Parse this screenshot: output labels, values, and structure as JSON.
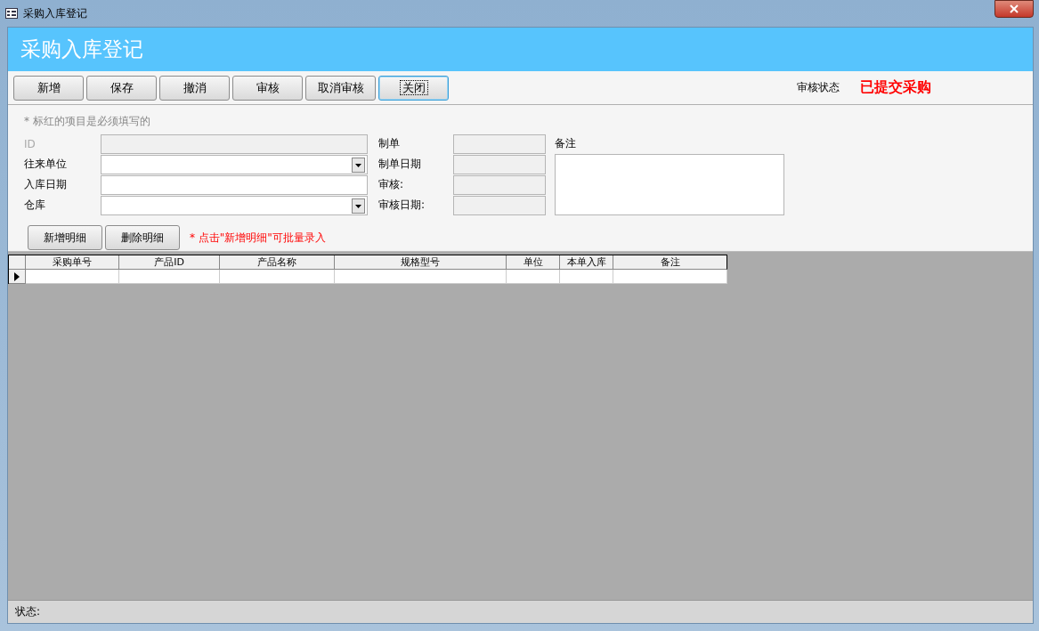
{
  "window": {
    "title": "采购入库登记"
  },
  "header": {
    "title": "采购入库登记"
  },
  "toolbar": {
    "buttons": [
      {
        "label": "新增",
        "focused": false
      },
      {
        "label": "保存",
        "focused": false
      },
      {
        "label": "撤消",
        "focused": false
      },
      {
        "label": "审核",
        "focused": false
      },
      {
        "label": "取消审核",
        "focused": false
      },
      {
        "label": "关闭",
        "focused": true
      }
    ]
  },
  "review_status": {
    "label": "审核状态",
    "value": "已提交采购"
  },
  "form": {
    "note": "* 标红的项目是必须填写的",
    "left_fields": [
      {
        "label": "ID",
        "kind": "text",
        "disabled": true
      },
      {
        "label": "往来单位",
        "kind": "combo",
        "disabled": false
      },
      {
        "label": "入库日期",
        "kind": "text",
        "disabled": false
      },
      {
        "label": "仓库",
        "kind": "combo",
        "disabled": false
      }
    ],
    "right_fields": [
      {
        "label": "制单"
      },
      {
        "label": "制单日期"
      },
      {
        "label": "审核:"
      },
      {
        "label": "审核日期:"
      }
    ],
    "remarks": {
      "label": "备注"
    }
  },
  "detail_buttons": [
    "新增明细",
    "删除明细"
  ],
  "detail_hint": "* 点击\"新增明细\"可批量录入",
  "grid": {
    "columns": [
      "采购单号",
      "产品ID",
      "产品名称",
      "规格型号",
      "单位",
      "本单入库",
      "备注"
    ]
  },
  "status_bar": {
    "label": "状态:"
  }
}
